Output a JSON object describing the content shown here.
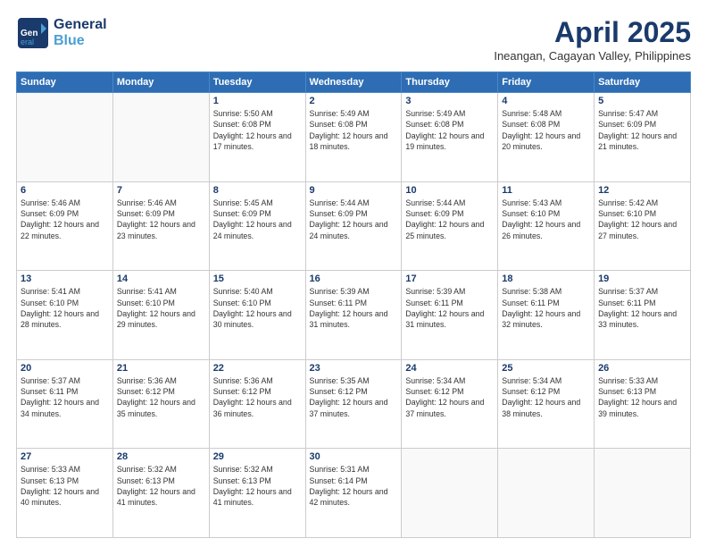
{
  "logo": {
    "line1": "General",
    "line2": "Blue"
  },
  "title": "April 2025",
  "location": "Ineangan, Cagayan Valley, Philippines",
  "days_of_week": [
    "Sunday",
    "Monday",
    "Tuesday",
    "Wednesday",
    "Thursday",
    "Friday",
    "Saturday"
  ],
  "weeks": [
    [
      {
        "day": null
      },
      {
        "day": null
      },
      {
        "day": 1,
        "rise": "5:50 AM",
        "set": "6:08 PM",
        "hours": "12 hours and 17 minutes."
      },
      {
        "day": 2,
        "rise": "5:49 AM",
        "set": "6:08 PM",
        "hours": "12 hours and 18 minutes."
      },
      {
        "day": 3,
        "rise": "5:49 AM",
        "set": "6:08 PM",
        "hours": "12 hours and 19 minutes."
      },
      {
        "day": 4,
        "rise": "5:48 AM",
        "set": "6:08 PM",
        "hours": "12 hours and 20 minutes."
      },
      {
        "day": 5,
        "rise": "5:47 AM",
        "set": "6:09 PM",
        "hours": "12 hours and 21 minutes."
      }
    ],
    [
      {
        "day": 6,
        "rise": "5:46 AM",
        "set": "6:09 PM",
        "hours": "12 hours and 22 minutes."
      },
      {
        "day": 7,
        "rise": "5:46 AM",
        "set": "6:09 PM",
        "hours": "12 hours and 23 minutes."
      },
      {
        "day": 8,
        "rise": "5:45 AM",
        "set": "6:09 PM",
        "hours": "12 hours and 24 minutes."
      },
      {
        "day": 9,
        "rise": "5:44 AM",
        "set": "6:09 PM",
        "hours": "12 hours and 24 minutes."
      },
      {
        "day": 10,
        "rise": "5:44 AM",
        "set": "6:09 PM",
        "hours": "12 hours and 25 minutes."
      },
      {
        "day": 11,
        "rise": "5:43 AM",
        "set": "6:10 PM",
        "hours": "12 hours and 26 minutes."
      },
      {
        "day": 12,
        "rise": "5:42 AM",
        "set": "6:10 PM",
        "hours": "12 hours and 27 minutes."
      }
    ],
    [
      {
        "day": 13,
        "rise": "5:41 AM",
        "set": "6:10 PM",
        "hours": "12 hours and 28 minutes."
      },
      {
        "day": 14,
        "rise": "5:41 AM",
        "set": "6:10 PM",
        "hours": "12 hours and 29 minutes."
      },
      {
        "day": 15,
        "rise": "5:40 AM",
        "set": "6:10 PM",
        "hours": "12 hours and 30 minutes."
      },
      {
        "day": 16,
        "rise": "5:39 AM",
        "set": "6:11 PM",
        "hours": "12 hours and 31 minutes."
      },
      {
        "day": 17,
        "rise": "5:39 AM",
        "set": "6:11 PM",
        "hours": "12 hours and 31 minutes."
      },
      {
        "day": 18,
        "rise": "5:38 AM",
        "set": "6:11 PM",
        "hours": "12 hours and 32 minutes."
      },
      {
        "day": 19,
        "rise": "5:37 AM",
        "set": "6:11 PM",
        "hours": "12 hours and 33 minutes."
      }
    ],
    [
      {
        "day": 20,
        "rise": "5:37 AM",
        "set": "6:11 PM",
        "hours": "12 hours and 34 minutes."
      },
      {
        "day": 21,
        "rise": "5:36 AM",
        "set": "6:12 PM",
        "hours": "12 hours and 35 minutes."
      },
      {
        "day": 22,
        "rise": "5:36 AM",
        "set": "6:12 PM",
        "hours": "12 hours and 36 minutes."
      },
      {
        "day": 23,
        "rise": "5:35 AM",
        "set": "6:12 PM",
        "hours": "12 hours and 37 minutes."
      },
      {
        "day": 24,
        "rise": "5:34 AM",
        "set": "6:12 PM",
        "hours": "12 hours and 37 minutes."
      },
      {
        "day": 25,
        "rise": "5:34 AM",
        "set": "6:12 PM",
        "hours": "12 hours and 38 minutes."
      },
      {
        "day": 26,
        "rise": "5:33 AM",
        "set": "6:13 PM",
        "hours": "12 hours and 39 minutes."
      }
    ],
    [
      {
        "day": 27,
        "rise": "5:33 AM",
        "set": "6:13 PM",
        "hours": "12 hours and 40 minutes."
      },
      {
        "day": 28,
        "rise": "5:32 AM",
        "set": "6:13 PM",
        "hours": "12 hours and 41 minutes."
      },
      {
        "day": 29,
        "rise": "5:32 AM",
        "set": "6:13 PM",
        "hours": "12 hours and 41 minutes."
      },
      {
        "day": 30,
        "rise": "5:31 AM",
        "set": "6:14 PM",
        "hours": "12 hours and 42 minutes."
      },
      {
        "day": null
      },
      {
        "day": null
      },
      {
        "day": null
      }
    ]
  ]
}
